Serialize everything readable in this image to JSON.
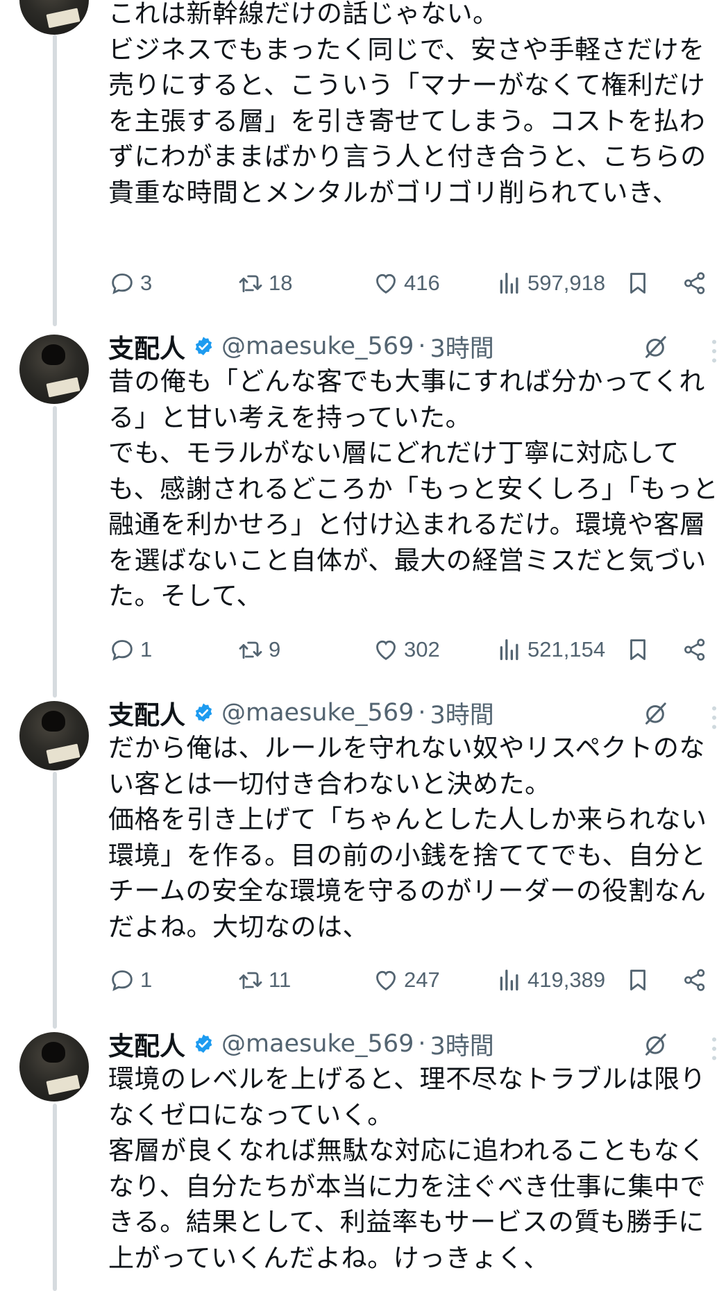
{
  "colors": {
    "verified": "#1d9bf0",
    "muted": "#536471",
    "text": "#0f1419",
    "thread_line": "#d6dbdf"
  },
  "tweets": [
    {
      "text": "これは新幹線だけの話じゃない。\nビジネスでもまったく同じで、安さや手軽さだけを売りにすると、こういう「マナーがなくて権利だけを主張する層」を引き寄せてしまう。コストを払わずにわがままばかり言う人と付き合うと、こちらの貴重な時間とメンタルがゴリゴリ削られていき、",
      "replies": "3",
      "reposts": "18",
      "likes": "416",
      "views": "597,918"
    },
    {
      "name": "支配人",
      "handle": "@maesuke_569",
      "separator": "·",
      "time": "3時間",
      "text": "昔の俺も「どんな客でも大事にすれば分かってくれる」と甘い考えを持っていた。\nでも、モラルがない層にどれだけ丁寧に対応しても、感謝されるどころか「もっと安くしろ」「もっと融通を利かせろ」と付け込まれるだけ。環境や客層を選ばないこと自体が、最大の経営ミスだと気づいた。そして、",
      "replies": "1",
      "reposts": "9",
      "likes": "302",
      "views": "521,154"
    },
    {
      "name": "支配人",
      "handle": "@maesuke_569",
      "separator": "·",
      "time": "3時間",
      "text": "だから俺は、ルールを守れない奴やリスペクトのない客とは一切付き合わないと決めた。\n価格を引き上げて「ちゃんとした人しか来られない環境」を作る。目の前の小銭を捨ててでも、自分とチームの安全な環境を守るのがリーダーの役割なんだよね。大切なのは、",
      "replies": "1",
      "reposts": "11",
      "likes": "247",
      "views": "419,389"
    },
    {
      "name": "支配人",
      "handle": "@maesuke_569",
      "separator": "·",
      "time": "3時間",
      "text": "環境のレベルを上げると、理不尽なトラブルは限りなくゼロになっていく。\n客層が良くなれば無駄な対応に追われることもなくなり、自分たちが本当に力を注ぐべき仕事に集中できる。結果として、利益率もサービスの質も勝手に上がっていくんだよね。けっきょく、"
    }
  ]
}
